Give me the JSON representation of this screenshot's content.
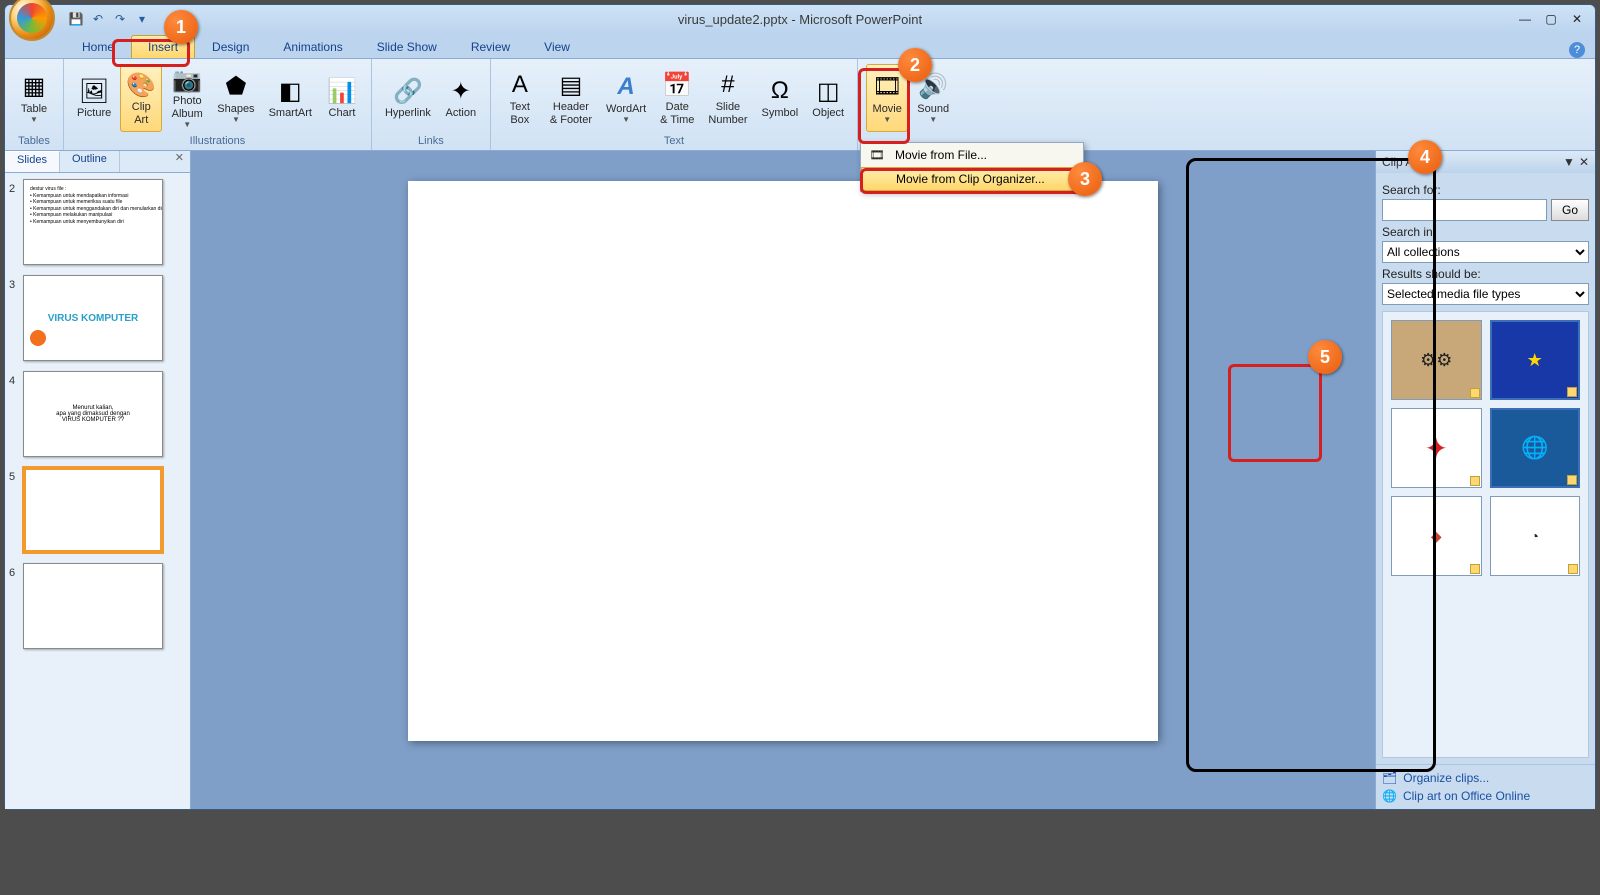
{
  "titlebar": {
    "title": "virus_update2.pptx - Microsoft PowerPoint"
  },
  "tabs": {
    "home": "Home",
    "insert": "Insert",
    "design": "Design",
    "animations": "Animations",
    "slideshow": "Slide Show",
    "review": "Review",
    "view": "View"
  },
  "ribbon": {
    "tables": {
      "label": "Tables",
      "table": "Table"
    },
    "illustrations": {
      "label": "Illustrations",
      "picture": "Picture",
      "clipart": "Clip\nArt",
      "photoalbum": "Photo\nAlbum",
      "shapes": "Shapes",
      "smartart": "SmartArt",
      "chart": "Chart"
    },
    "links": {
      "label": "Links",
      "hyperlink": "Hyperlink",
      "action": "Action"
    },
    "text": {
      "label": "Text",
      "textbox": "Text\nBox",
      "headerfooter": "Header\n& Footer",
      "wordart": "WordArt",
      "datetime": "Date\n& Time",
      "slidenumber": "Slide\nNumber",
      "symbol": "Symbol",
      "object": "Object"
    },
    "mediaclips": {
      "movie": "Movie",
      "sound": "Sound"
    }
  },
  "movie_menu": {
    "file": "Movie from File...",
    "organizer": "Movie from Clip Organizer..."
  },
  "slides_panel": {
    "slides": "Slides",
    "outline": "Outline",
    "nums": [
      "2",
      "3",
      "4",
      "5",
      "6"
    ],
    "s2": "destur virus file :\n• Kemampuan untuk mendapatkan informasi\n• Kemampuan untuk memeriksa suatu file\n• Kemampuan untuk menggandakan diri dan menularkan diri\n• Kemampuan melakukan manipulasi\n• Kemampuan untuk menyembunyikan diri",
    "s3": "VIRUS KOMPUTER",
    "s4": "Menurut kalian,\napa yang dimaksud dengan\nVIRUS KOMPUTER ??"
  },
  "clipart": {
    "title": "Clip Art",
    "search_for": "Search for:",
    "go": "Go",
    "search_in": "Search in:",
    "search_in_val": "All collections",
    "results_should": "Results should be:",
    "results_val": "Selected media file types",
    "organize": "Organize clips...",
    "online": "Clip art on Office Online"
  },
  "callouts": {
    "c1": "1",
    "c2": "2",
    "c3": "3",
    "c4": "4",
    "c5": "5"
  }
}
